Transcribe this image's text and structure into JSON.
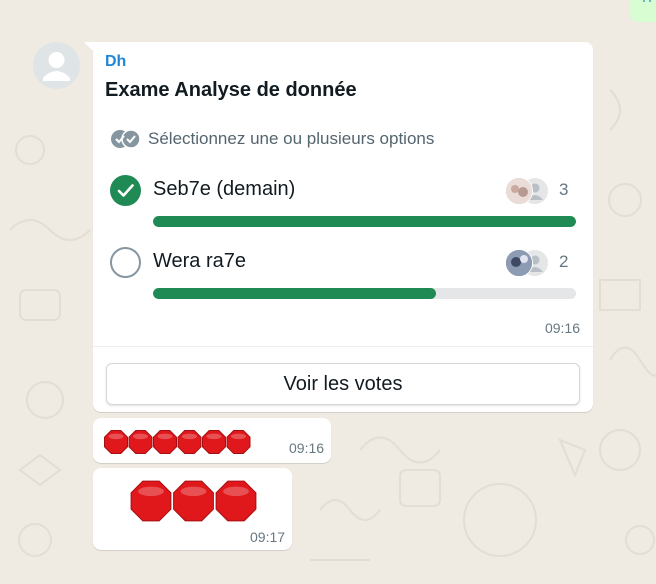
{
  "chat": {
    "outgoing_peek_text": "n"
  },
  "poll": {
    "sender": "Dh",
    "question": "Exame Analyse de donnée",
    "hint": "Sélectionnez une ou plusieurs options",
    "options": [
      {
        "label": "Seb7e (demain)",
        "votes": "3",
        "selected": true,
        "fill_fraction": 1.0
      },
      {
        "label": "Wera ra7e",
        "votes": "2",
        "selected": false,
        "fill_fraction": 0.67
      }
    ],
    "time": "09:16",
    "view_votes_label": "Voir les votes"
  },
  "messages": [
    {
      "emoji": "🛑🛑🛑🛑🛑🛑",
      "count": 6,
      "time": "09:16"
    },
    {
      "emoji": "🛑🛑🛑",
      "count": 3,
      "time": "09:17"
    }
  ],
  "colors": {
    "accent_green": "#1f8a53",
    "sender_blue": "#1f86d6",
    "wallpaper": "#efeae2"
  }
}
